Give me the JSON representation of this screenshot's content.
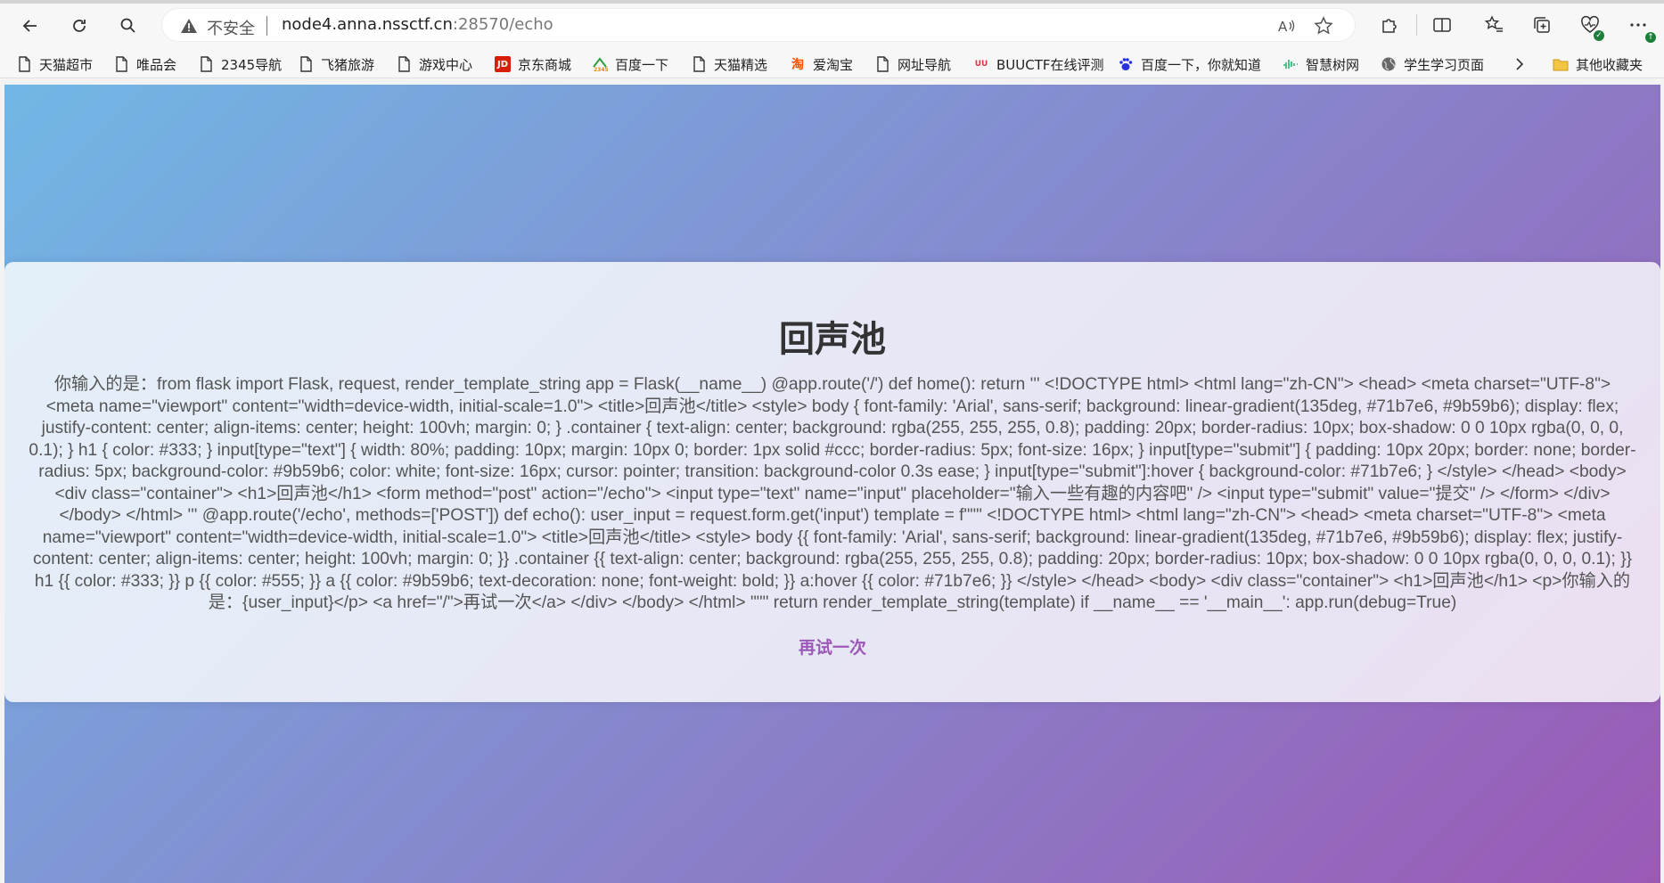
{
  "browser": {
    "insecure_label": "不安全",
    "url_host": "node4.anna.nssctf.cn",
    "url_rest": ":28570/echo"
  },
  "bookmarks": [
    {
      "label": "天猫超市",
      "icon": "page-icon"
    },
    {
      "label": "唯品会",
      "icon": "page-icon"
    },
    {
      "label": "2345导航",
      "icon": "page-icon"
    },
    {
      "label": "飞猪旅游",
      "icon": "page-icon"
    },
    {
      "label": "游戏中心",
      "icon": "page-icon"
    },
    {
      "label": "京东商城",
      "icon": "jd-icon"
    },
    {
      "label": "百度一下",
      "icon": "2345-icon"
    },
    {
      "label": "天猫精选",
      "icon": "page-icon"
    },
    {
      "label": "爱淘宝",
      "icon": "taobao-icon"
    },
    {
      "label": "网址导航",
      "icon": "page-icon"
    },
    {
      "label": "BUUCTF在线评测",
      "icon": "buuctf-icon"
    },
    {
      "label": "百度一下，你就知道",
      "icon": "baidu-paw-icon"
    },
    {
      "label": "智慧树网",
      "icon": "zhihuishu-icon"
    },
    {
      "label": "学生学习页面",
      "icon": "globe-icon"
    }
  ],
  "other_bookmarks": "其他收藏夹",
  "page": {
    "title": "回声池",
    "message": "你输入的是：from flask import Flask, request, render_template_string app = Flask(__name__) @app.route('/') def home(): return ''' <!DOCTYPE html> <html lang=\"zh-CN\"> <head> <meta charset=\"UTF-8\"> <meta name=\"viewport\" content=\"width=device-width, initial-scale=1.0\"> <title>回声池</title> <style> body { font-family: 'Arial', sans-serif; background: linear-gradient(135deg, #71b7e6, #9b59b6); display: flex; justify-content: center; align-items: center; height: 100vh; margin: 0; } .container { text-align: center; background: rgba(255, 255, 255, 0.8); padding: 20px; border-radius: 10px; box-shadow: 0 0 10px rgba(0, 0, 0, 0.1); } h1 { color: #333; } input[type=\"text\"] { width: 80%; padding: 10px; margin: 10px 0; border: 1px solid #ccc; border-radius: 5px; font-size: 16px; } input[type=\"submit\"] { padding: 10px 20px; border: none; border-radius: 5px; background-color: #9b59b6; color: white; font-size: 16px; cursor: pointer; transition: background-color 0.3s ease; } input[type=\"submit\"]:hover { background-color: #71b7e6; } </style> </head> <body> <div class=\"container\"> <h1>回声池</h1> <form method=\"post\" action=\"/echo\"> <input type=\"text\" name=\"input\" placeholder=\"输入一些有趣的内容吧\" /> <input type=\"submit\" value=\"提交\" /> </form> </div> </body> </html> ''' @app.route('/echo', methods=['POST']) def echo(): user_input = request.form.get('input') template = f\"\"\" <!DOCTYPE html> <html lang=\"zh-CN\"> <head> <meta charset=\"UTF-8\"> <meta name=\"viewport\" content=\"width=device-width, initial-scale=1.0\"> <title>回声池</title> <style> body {{ font-family: 'Arial', sans-serif; background: linear-gradient(135deg, #71b7e6, #9b59b6); display: flex; justify-content: center; align-items: center; height: 100vh; margin: 0; }} .container {{ text-align: center; background: rgba(255, 255, 255, 0.8); padding: 20px; border-radius: 10px; box-shadow: 0 0 10px rgba(0, 0, 0, 0.1); }} h1 {{ color: #333; }} p {{ color: #555; }} a {{ color: #9b59b6; text-decoration: none; font-weight: bold; }} a:hover {{ color: #71b7e6; }} </style> </head> <body> <div class=\"container\"> <h1>回声池</h1> <p>你输入的是：{user_input}</p> <a href=\"/\">再试一次</a> </div> </body> </html> \"\"\" return render_template_string(template) if __name__ == '__main__': app.run(debug=True)",
    "retry_link": "再试一次"
  },
  "colors": {
    "gradient_start": "#71b7e6",
    "gradient_end": "#9b59b6",
    "heading": "#333333",
    "text": "#555555",
    "link": "#9b59b6"
  }
}
